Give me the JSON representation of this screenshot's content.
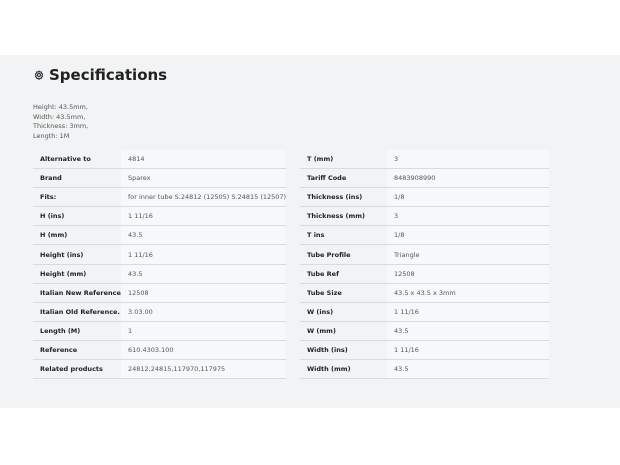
{
  "section": {
    "title": "Specifications",
    "icon": "gear-icon"
  },
  "summary": [
    "Height: 43.5mm,",
    "Width: 43.5mm,",
    "Thickness: 3mm,",
    "Length: 1M"
  ],
  "left_table": [
    {
      "key": "Alternative to",
      "value": "4814"
    },
    {
      "key": "Brand",
      "value": "Sparex"
    },
    {
      "key": "Fits:",
      "value": "for inner tube S.24812 (12505) S.24815 (12507)"
    },
    {
      "key": "H (ins)",
      "value": "1 11/16"
    },
    {
      "key": "H (mm)",
      "value": "43.5"
    },
    {
      "key": "Height (ins)",
      "value": "1 11/16"
    },
    {
      "key": "Height (mm)",
      "value": "43.5"
    },
    {
      "key": "Italian New Reference",
      "value": "12508"
    },
    {
      "key": "Italian Old Reference.",
      "value": "3.03.00"
    },
    {
      "key": "Length (M)",
      "value": "1"
    },
    {
      "key": "Reference",
      "value": "610.4303.100"
    },
    {
      "key": "Related products",
      "value": "24812,24815,117970,117975"
    }
  ],
  "right_table": [
    {
      "key": "T (mm)",
      "value": "3"
    },
    {
      "key": "Tariff Code",
      "value": "8483908990"
    },
    {
      "key": "Thickness (ins)",
      "value": "1/8"
    },
    {
      "key": "Thickness (mm)",
      "value": "3"
    },
    {
      "key": "T ins",
      "value": "1/8"
    },
    {
      "key": "Tube Profile",
      "value": "Triangle"
    },
    {
      "key": "Tube Ref",
      "value": "12508"
    },
    {
      "key": "Tube Size",
      "value": "43.5 x 43.5 x 3mm"
    },
    {
      "key": "W (ins)",
      "value": "1 11/16"
    },
    {
      "key": "W (mm)",
      "value": "43.5"
    },
    {
      "key": "Width (ins)",
      "value": "1 11/16"
    },
    {
      "key": "Width (mm)",
      "value": "43.5"
    }
  ]
}
